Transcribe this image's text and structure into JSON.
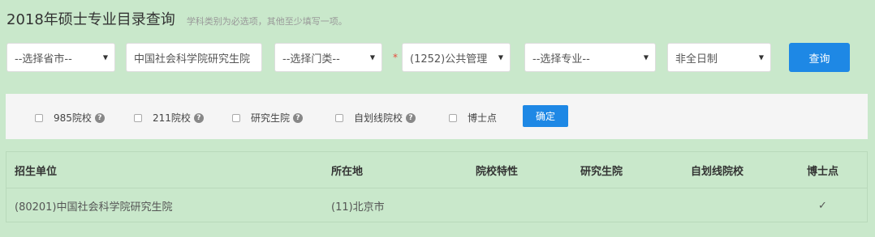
{
  "header": {
    "title": "2018年硕士专业目录查询",
    "hint": "学科类别为必选项，其他至少填写一项。"
  },
  "search": {
    "province": {
      "value": "--选择省市--"
    },
    "institution": {
      "value": "中国社会科学院研究生院"
    },
    "category": {
      "value": "--选择门类--"
    },
    "required_mark": "*",
    "discipline": {
      "value": "(1252)公共管理"
    },
    "major": {
      "value": "--选择专业--"
    },
    "study_mode": {
      "value": "非全日制"
    },
    "query_label": "查询"
  },
  "filters": {
    "items": [
      {
        "label": "985院校",
        "help": "?"
      },
      {
        "label": "211院校",
        "help": "?"
      },
      {
        "label": "研究生院",
        "help": "?"
      },
      {
        "label": "自划线院校",
        "help": "?"
      },
      {
        "label": "博士点"
      }
    ],
    "confirm_label": "确定"
  },
  "table": {
    "columns": [
      "招生单位",
      "所在地",
      "院校特性",
      "研究生院",
      "自划线院校",
      "博士点"
    ],
    "rows": [
      [
        "(80201)中国社会科学院研究生院",
        "(11)北京市",
        "",
        "",
        "",
        "✓"
      ]
    ]
  }
}
